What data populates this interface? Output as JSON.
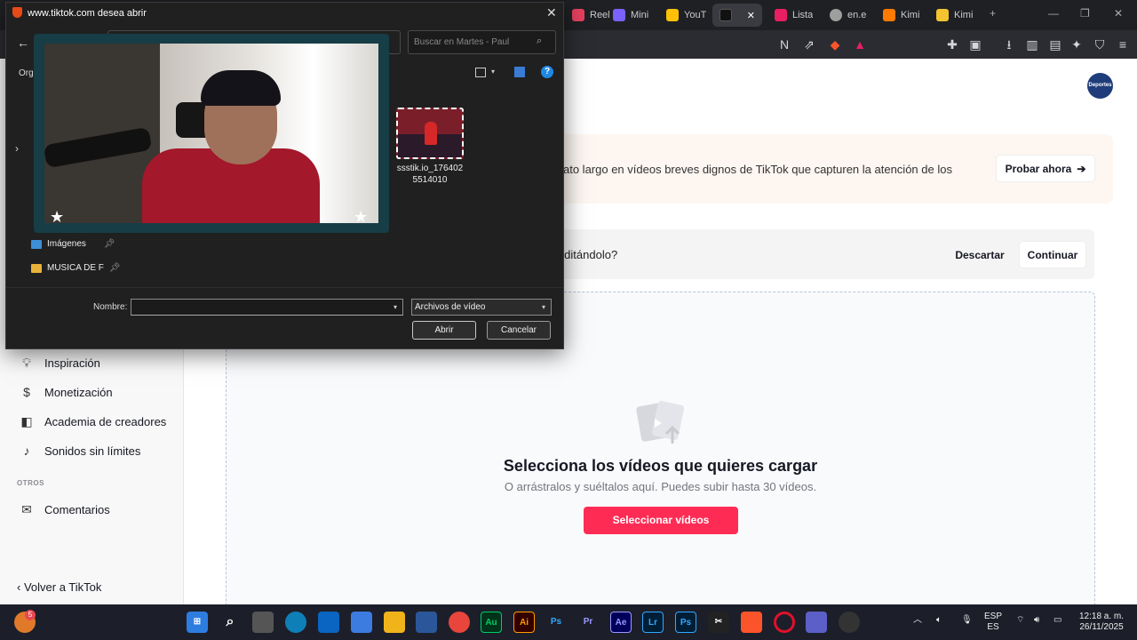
{
  "browser": {
    "tabs": [
      {
        "label": "Reel",
        "color": "#e4405f"
      },
      {
        "label": "Mini",
        "color": "#7b61ff"
      },
      {
        "label": "YouT",
        "color": "#ffc107"
      },
      {
        "label": "",
        "color": "#111111"
      },
      {
        "label": "Lista",
        "color": "#e91e63"
      },
      {
        "label": "en.e",
        "color": "#9e9e9e"
      },
      {
        "label": "Kimi",
        "color": "#ff7a00"
      },
      {
        "label": "Kimi",
        "color": "#f4c430"
      }
    ],
    "new_tab": "+"
  },
  "dialog": {
    "title": "www.tiktok.com desea abrir",
    "search_placeholder": "Buscar en Martes - Paul",
    "organize_label": "Orga",
    "nav_items": [
      {
        "label": "Imágenes",
        "icon": "image-icon"
      },
      {
        "label": "MUSICA DE F",
        "icon": "folder-icon"
      }
    ],
    "file": {
      "name": "ssstik.io_1764025514010"
    },
    "nombre_label": "Nombre:",
    "nombre_value": "",
    "file_type": "Archivos de vídeo",
    "open_button": "Abrir",
    "cancel_button": "Cancelar"
  },
  "header": {
    "avatar_text": "Deportes"
  },
  "sidebar": {
    "items": [
      {
        "label": "Inspiración",
        "icon": "lightbulb-icon"
      },
      {
        "label": "Monetización",
        "icon": "dollar-icon"
      },
      {
        "label": "Academia de creadores",
        "icon": "academy-icon"
      },
      {
        "label": "Sonidos sin límites",
        "icon": "music-note-icon"
      }
    ],
    "section_otros": "OTROS",
    "comments": {
      "label": "Comentarios",
      "icon": "mail-icon"
    },
    "back_link": "Volver a TikTok"
  },
  "promo": {
    "text": "ato largo en vídeos breves dignos de TikTok que capturen la atención de los",
    "button": "Probar ahora"
  },
  "draft": {
    "text": "r editándolo?",
    "discard": "Descartar",
    "continue": "Continuar"
  },
  "upload": {
    "title": "Selecciona los vídeos que quieres cargar",
    "subtitle": "O arrástralos y suéltalos aquí. Puedes subir hasta 30 vídeos.",
    "button": "Seleccionar vídeos"
  },
  "taskbar": {
    "notification_badge": "5",
    "apps": [
      {
        "label": "Au",
        "color": "#00cc66"
      },
      {
        "label": "Ai",
        "color": "#ff9a00"
      },
      {
        "label": "Ps",
        "color": "#31a8ff"
      },
      {
        "label": "Pr",
        "color": "#9999ff"
      },
      {
        "label": "Ae",
        "color": "#9999ff"
      },
      {
        "label": "Lr",
        "color": "#31a8ff"
      },
      {
        "label": "Ps",
        "color": "#31a8ff"
      }
    ],
    "language": "ESP",
    "language_sub": "ES",
    "time": "12:18 a. m.",
    "date": "26/11/2025"
  }
}
